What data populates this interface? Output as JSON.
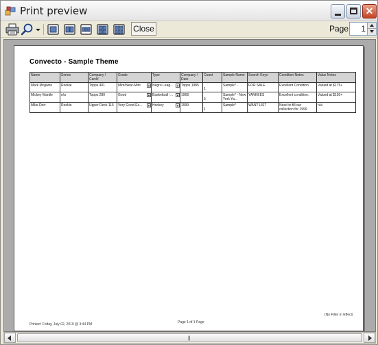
{
  "window": {
    "title": "Print preview"
  },
  "toolbar": {
    "close_label": "Close",
    "page_label": "Page",
    "page_value": "1",
    "icons": [
      "printer-icon",
      "zoom-icon",
      "one-page-icon",
      "two-pages-icon",
      "three-pages-icon",
      "four-pages-icon",
      "six-pages-icon"
    ]
  },
  "document": {
    "title": "Convecto - Sample Theme",
    "columns": [
      "Name",
      "Series",
      "Company / Card#",
      "Grade",
      "Type",
      "Company / Date",
      "Count",
      "Sample Name",
      "Search Keys",
      "Condition Notes",
      "Value Notes"
    ],
    "rows": [
      [
        "Mark Mcgwire",
        "Rookie",
        "Topps 401",
        "Mint/Near-Mint",
        "Negro Leag...",
        "Topps 1985",
        "1",
        "Sample* -",
        "FOR SALE",
        "Excellent Condition",
        "Valued at $175+"
      ],
      [
        "Mickey Mantle",
        "n/a",
        "Topps 280",
        "Good",
        "Basketball -...",
        "1968",
        "5",
        "Sample* - New York Ya...",
        "YANKEES",
        "Excellent condition.",
        "Valued at $150+"
      ],
      [
        "Mike Dorr",
        "Rookie",
        "Upper Deck 115",
        "Very Good-Ex...",
        "Hockey",
        "1999",
        "1",
        "Sample*",
        "WANT LIST",
        "Need to fill our collection for 1999",
        "n/a"
      ]
    ],
    "footer_filter": "(No Filter in Effect)",
    "footer_printed": "Printed:   Friday, July 02, 2010 @ 3:44 PM",
    "footer_page": "Page 1 of 1 Page"
  }
}
